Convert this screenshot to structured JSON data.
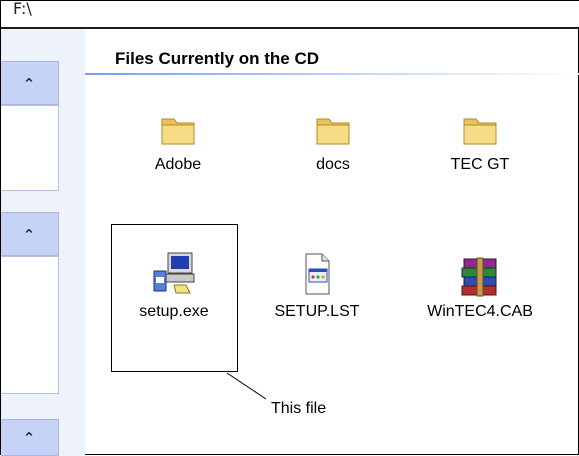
{
  "address": {
    "path": "F:\\"
  },
  "section": {
    "title": "Files Currently on the CD"
  },
  "items": [
    {
      "name": "Adobe",
      "icon": "folder-icon",
      "type": "folder"
    },
    {
      "name": "docs",
      "icon": "folder-icon",
      "type": "folder"
    },
    {
      "name": "TEC GT",
      "icon": "folder-icon",
      "type": "folder"
    },
    {
      "name": "setup.exe",
      "icon": "setup-computer-icon",
      "type": "file",
      "selected": true
    },
    {
      "name": "SETUP.LST",
      "icon": "document-icon",
      "type": "file"
    },
    {
      "name": "WinTEC4.CAB",
      "icon": "archive-books-icon",
      "type": "file"
    }
  ],
  "annotation": {
    "text": "This file"
  },
  "tasks_pane": {
    "collapse_glyph": "»"
  },
  "colors": {
    "folder": "#f2d77a",
    "panel_header": "#c6d3f7",
    "selection_border": "#000000"
  }
}
